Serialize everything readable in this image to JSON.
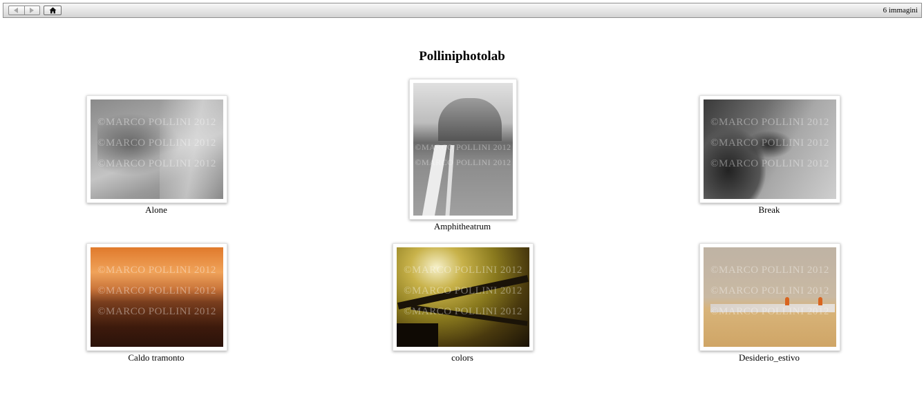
{
  "toolbar": {
    "image_count": "6 immagini"
  },
  "gallery": {
    "title": "Polliniphotolab",
    "watermark": "©MARCO POLLINI 2012",
    "items": [
      {
        "caption": "Alone"
      },
      {
        "caption": "Amphitheatrum"
      },
      {
        "caption": "Break"
      },
      {
        "caption": "Caldo tramonto"
      },
      {
        "caption": "colors"
      },
      {
        "caption": "Desiderio_estivo"
      }
    ]
  }
}
